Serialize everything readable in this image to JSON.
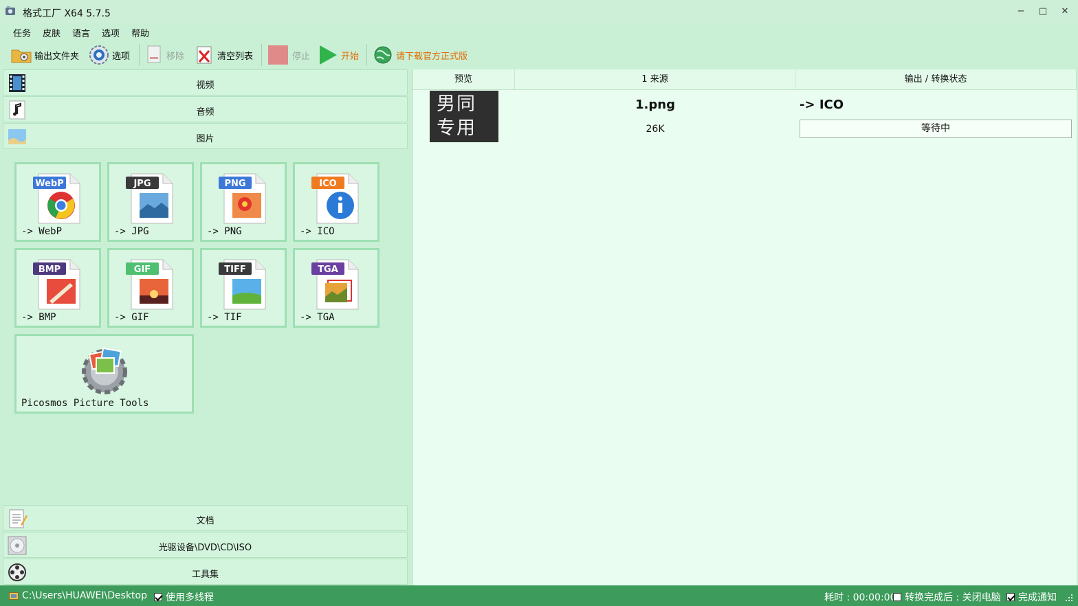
{
  "window": {
    "title": "格式工厂 X64 5.7.5",
    "controls": {
      "minimize": "−",
      "maximize": "□",
      "close": "✕"
    }
  },
  "menu": [
    "任务",
    "皮肤",
    "语言",
    "选项",
    "帮助"
  ],
  "toolbar": {
    "output_folder": "输出文件夹",
    "options": "选项",
    "remove": "移除",
    "clear_list": "清空列表",
    "stop": "停止",
    "start": "开始",
    "download": "请下载官方正式版"
  },
  "categories": {
    "video": "视频",
    "audio": "音频",
    "image": "图片",
    "document": "文档",
    "disc": "光驱设备\\DVD\\CD\\ISO",
    "tools": "工具集"
  },
  "formats": [
    {
      "tag": "WebP",
      "label": "-> WebP",
      "color": "#3d78d8",
      "icon": "chrome-icon"
    },
    {
      "tag": "JPG",
      "label": "-> JPG",
      "color": "#3a3a3a",
      "icon": "landscape-icon"
    },
    {
      "tag": "PNG",
      "label": "-> PNG",
      "color": "#3d78d8",
      "icon": "flower-icon"
    },
    {
      "tag": "ICO",
      "label": "-> ICO",
      "color": "#f07a1f",
      "icon": "info-icon"
    },
    {
      "tag": "BMP",
      "label": "-> BMP",
      "color": "#4d3a7e",
      "icon": "paint-icon"
    },
    {
      "tag": "GIF",
      "label": "-> GIF",
      "color": "#4fbf72",
      "icon": "sunset-icon"
    },
    {
      "tag": "TIFF",
      "label": "-> TIF",
      "color": "#3a3a3a",
      "icon": "field-icon"
    },
    {
      "tag": "TGA",
      "label": "-> TGA",
      "color": "#6a3fa0",
      "icon": "photo-icon"
    }
  ],
  "picosmos": {
    "label": "Picosmos Picture Tools",
    "icon": "gear-photos-icon"
  },
  "table": {
    "headers": [
      "预览",
      "1 来源",
      "输出 / 转换状态"
    ],
    "rows": [
      {
        "preview_text_1": "男同",
        "preview_text_2": "专用",
        "filename": "1.png",
        "size": "26K",
        "output": "-> ICO",
        "status": "等待中"
      }
    ]
  },
  "statusbar": {
    "path": "C:\\Users\\HUAWEI\\Desktop",
    "multithread": "使用多线程",
    "elapsed": "耗时 : 00:00:00",
    "after_convert": "转换完成后 : 关闭电脑",
    "notify": "完成通知",
    "multithread_checked": true,
    "after_convert_checked": false,
    "notify_checked": true
  },
  "colors": {
    "background": "#c9f0d5",
    "right_panel": "#e9fdf0",
    "statusbar": "#3d9b5b",
    "start_green": "#2fb34a",
    "stop_red": "#e08a8a",
    "download_orange": "#e46a00"
  }
}
